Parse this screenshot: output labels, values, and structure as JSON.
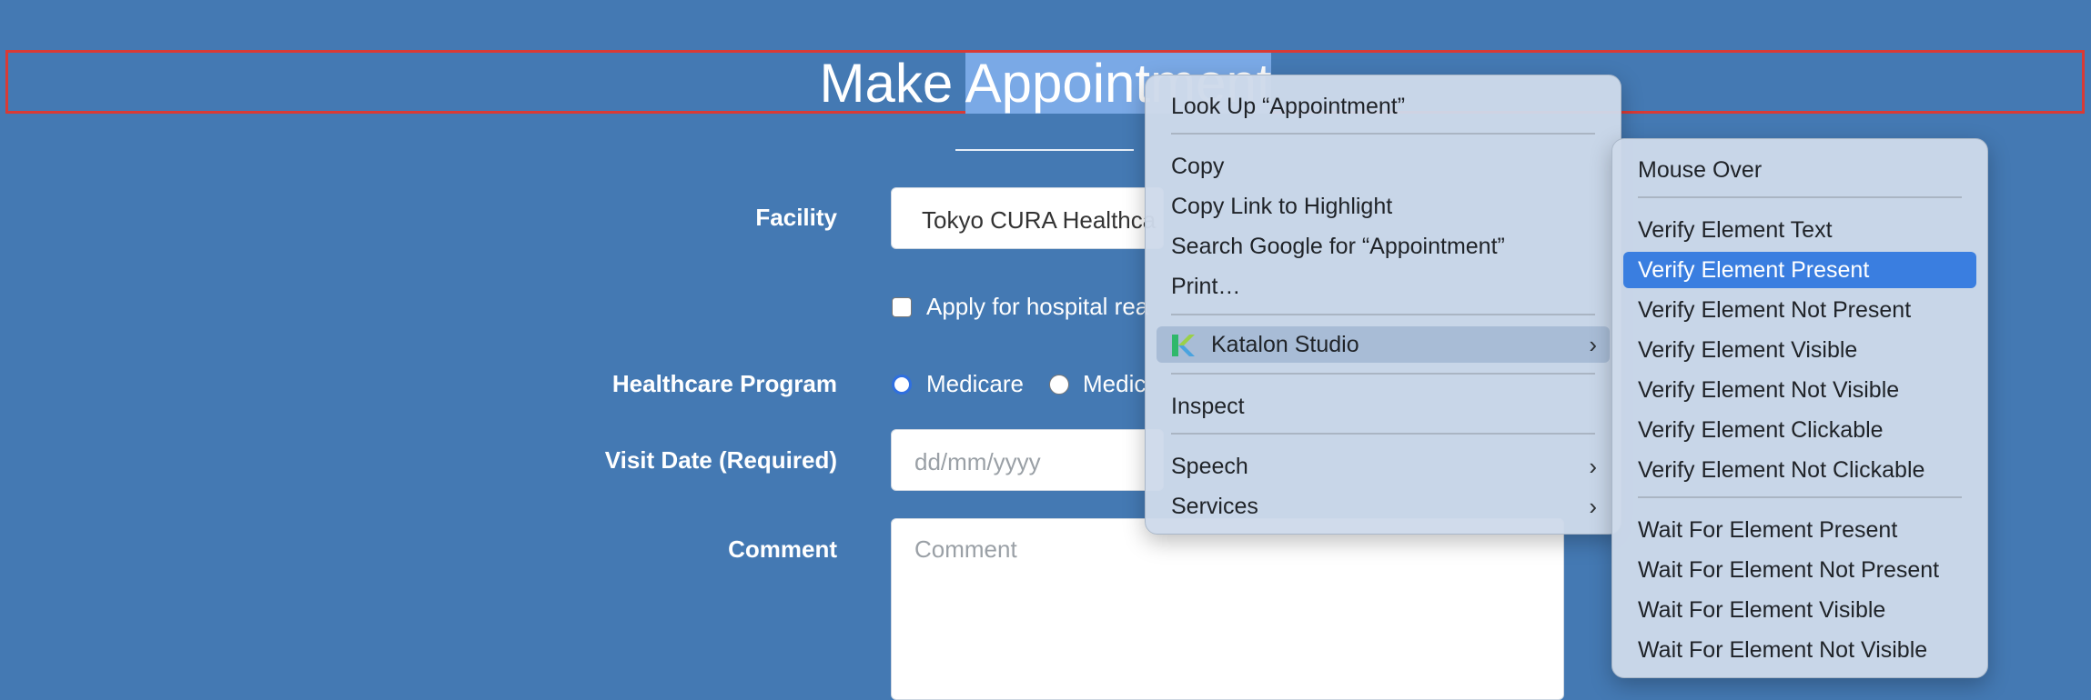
{
  "page": {
    "title_before": "Make ",
    "title_selected": "Appointment",
    "form": {
      "facility_label": "Facility",
      "facility_value": "Tokyo CURA Healthca",
      "readmission_label": "Apply for hospital rea",
      "program_label": "Healthcare Program",
      "program_options": [
        "Medicare",
        "Medic"
      ],
      "visit_label": "Visit Date (Required)",
      "visit_placeholder": "dd/mm/yyyy",
      "comment_label": "Comment",
      "comment_placeholder": "Comment"
    }
  },
  "context_menu": {
    "items": [
      "Look Up “Appointment”",
      "Copy",
      "Copy Link to Highlight",
      "Search Google for “Appointment”",
      "Print…",
      "Katalon Studio",
      "Inspect",
      "Speech",
      "Services"
    ],
    "katalon_icon": "katalon-logo-icon"
  },
  "submenu": {
    "items": [
      "Mouse Over",
      "Verify Element Text",
      "Verify Element Present",
      "Verify Element Not Present",
      "Verify Element Visible",
      "Verify Element Not Visible",
      "Verify Element Clickable",
      "Verify Element Not Clickable",
      "Wait For Element Present",
      "Wait For Element Not Present",
      "Wait For Element Visible",
      "Wait For Element Not Visible"
    ]
  },
  "colors": {
    "background": "#4479b3",
    "selection": "#7aa9e6",
    "highlight_border": "#d93a35",
    "menu_active": "#3a7ee0"
  }
}
